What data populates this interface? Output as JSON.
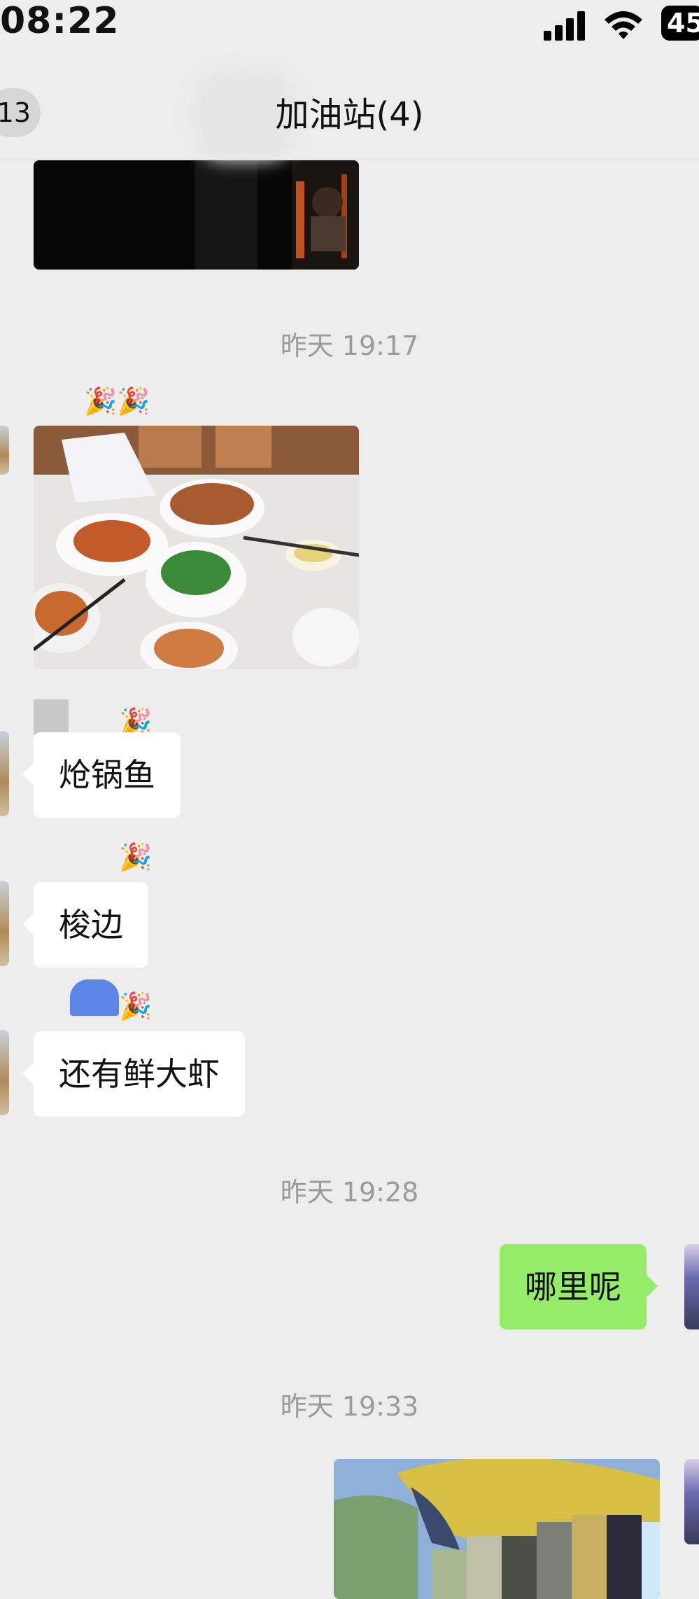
{
  "status_bar": {
    "time": "08:22",
    "battery": "45"
  },
  "nav": {
    "back_count": "13",
    "title": "加油站(4)"
  },
  "messages": [
    {
      "type": "image",
      "direction": "incoming",
      "desc": "dark-photo"
    },
    {
      "type": "timestamp",
      "text": "昨天 19:17"
    },
    {
      "type": "image",
      "direction": "incoming",
      "sender_emoji": "🎉🎉",
      "desc": "food-photo"
    },
    {
      "type": "text",
      "direction": "incoming",
      "sender_emoji": "🎉",
      "text": "炝锅鱼"
    },
    {
      "type": "text",
      "direction": "incoming",
      "sender_emoji": "🎉",
      "text": "梭边"
    },
    {
      "type": "text",
      "direction": "incoming",
      "sender_emoji": "🎉",
      "text": "还有鲜大虾"
    },
    {
      "type": "timestamp",
      "text": "昨天 19:28"
    },
    {
      "type": "text",
      "direction": "outgoing",
      "text": "哪里呢"
    },
    {
      "type": "timestamp",
      "text": "昨天 19:33"
    },
    {
      "type": "image",
      "direction": "outgoing",
      "desc": "outdoor-photo"
    }
  ],
  "colors": {
    "background": "#ededed",
    "outgoing_bubble": "#95ec69",
    "incoming_bubble": "#ffffff",
    "timestamp_text": "#9b9b9b"
  }
}
